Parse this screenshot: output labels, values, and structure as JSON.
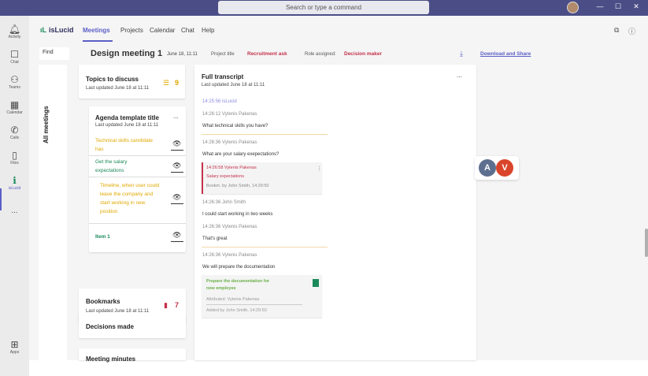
{
  "window": {
    "search_placeholder": "Search or type a command"
  },
  "rail": {
    "items": [
      {
        "label": "Activity",
        "icon": "bell-icon"
      },
      {
        "label": "Chat",
        "icon": "chat-icon"
      },
      {
        "label": "Teams",
        "icon": "teams-icon"
      },
      {
        "label": "Calendar",
        "icon": "calendar-icon"
      },
      {
        "label": "Calls",
        "icon": "phone-icon"
      },
      {
        "label": "Files",
        "icon": "file-icon"
      },
      {
        "label": "isLucid",
        "icon": "islucid-icon"
      },
      {
        "label": "Apps",
        "icon": "apps-icon"
      }
    ],
    "more": "..."
  },
  "app": {
    "logo": "isLucid",
    "nav": [
      "Meetings",
      "Projects",
      "Calendar",
      "Chat",
      "Help"
    ]
  },
  "meeting": {
    "find_label": "Find",
    "title": "Design meeting 1",
    "date": "June 18, 11:11",
    "project_label": "Project title",
    "project_value": "Recruitment ask",
    "role_label": "Role assigned:",
    "role_value": "Decision maker",
    "download_share": "Download and Share",
    "side_tab": "All meetings"
  },
  "topics": {
    "title": "Topics to discuss",
    "updated": "Last updated June 18 at 11:11",
    "count": "9"
  },
  "agenda": {
    "title": "Agenda template title",
    "updated": "Last updated June 18 at 11:11",
    "menu": "...",
    "items": [
      {
        "lines": [
          "Technical skills candidate",
          "has"
        ],
        "color": "#e0a800"
      },
      {
        "lines": [
          "Get the salary",
          "expectations"
        ],
        "color": "#1a8a5a"
      },
      {
        "lines": [
          "Timeline, when user could",
          "leave the company and",
          "start working in new",
          "position"
        ],
        "color": "#e0a800"
      },
      {
        "lines": [
          "Item 1"
        ],
        "color": "#1a8a5a"
      }
    ]
  },
  "bookmarks": {
    "title": "Bookmarks",
    "updated": "Last updated June 18 at 11:11",
    "count": "7"
  },
  "decisions": {
    "title": "Decisions made"
  },
  "minutes": {
    "title": "Meeting minutes"
  },
  "transcript": {
    "title": "Full transcript",
    "updated": "Last updated June 18 at 11:11",
    "menu": "...",
    "entries": [
      {
        "time": "14:25:56 isLucid",
        "text": ""
      },
      {
        "time": "14:26:12 Vytenis Pakenas",
        "text": "What technical skills you have?"
      },
      {
        "time": "14:26:36 Vytenis Pakenas",
        "text": "What are your salary exepectations?"
      },
      {
        "time": "14:26:36 John Smith",
        "text": "I could start working in two weeks"
      },
      {
        "time": "14:26:36 Vytenis Pakenas",
        "text": "That's great"
      },
      {
        "time": "14:26:36 Vytenis Pakenas",
        "text": "We will prepare the documentation"
      }
    ],
    "bookmark_card": {
      "time": "14:26:58 Vytenis Pakenas",
      "label": "Salary expectations",
      "by": "Bookm. by John Smith, 14:29:50"
    },
    "task_card": {
      "title_lines": [
        "Prepare the documentation for",
        "new employee"
      ],
      "attributed": "Attributed: Vytenis Pakenas",
      "added": "Added by John Smith, 14:29:50"
    }
  },
  "participants": [
    "A",
    "V"
  ],
  "colors": {
    "accent": "#5b5fc7",
    "red": "#c4314b",
    "yellow": "#e0a800",
    "green": "#1a8a5a",
    "participant_a": "#5d6f8f",
    "participant_v": "#d9452b"
  }
}
